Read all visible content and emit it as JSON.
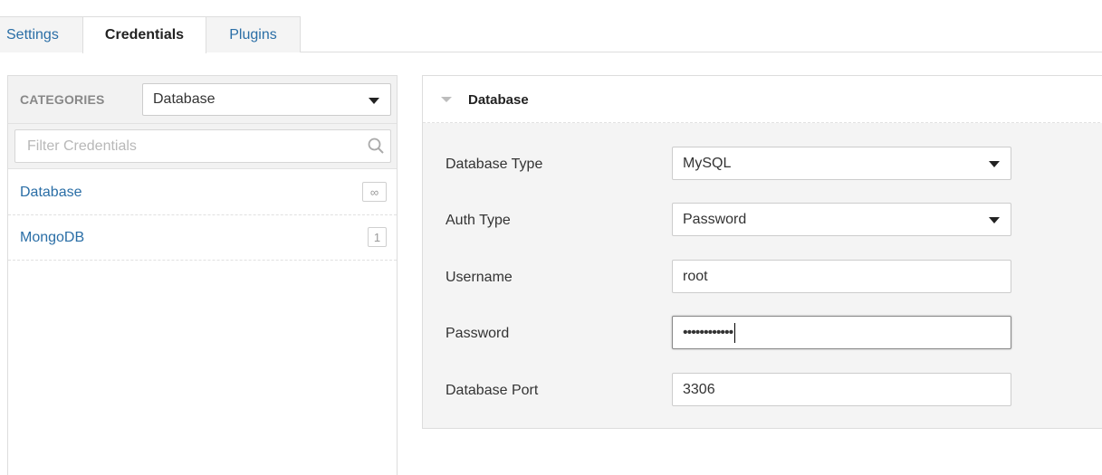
{
  "tabs": {
    "settings": "Settings",
    "credentials": "Credentials",
    "plugins": "Plugins"
  },
  "sidebar": {
    "categories_label": "CATEGORIES",
    "category_selected": "Database",
    "filter_placeholder": "Filter Credentials",
    "items": [
      {
        "label": "Database",
        "badge": "∞"
      },
      {
        "label": "MongoDB",
        "badge": "1"
      }
    ]
  },
  "detail": {
    "title": "Database",
    "fields": {
      "database_type": {
        "label": "Database Type",
        "value": "MySQL"
      },
      "auth_type": {
        "label": "Auth Type",
        "value": "Password"
      },
      "username": {
        "label": "Username",
        "value": "root"
      },
      "password": {
        "label": "Password",
        "value": "••••••••••••"
      },
      "port": {
        "label": "Database Port",
        "value": "3306"
      }
    }
  },
  "icons": {
    "search": "search-icon",
    "dropdown": "chevron-down-icon",
    "collapse": "collapse-icon"
  },
  "colors": {
    "link": "#2a6ea6",
    "panel_bg": "#f4f4f4",
    "border": "#dddddd"
  }
}
